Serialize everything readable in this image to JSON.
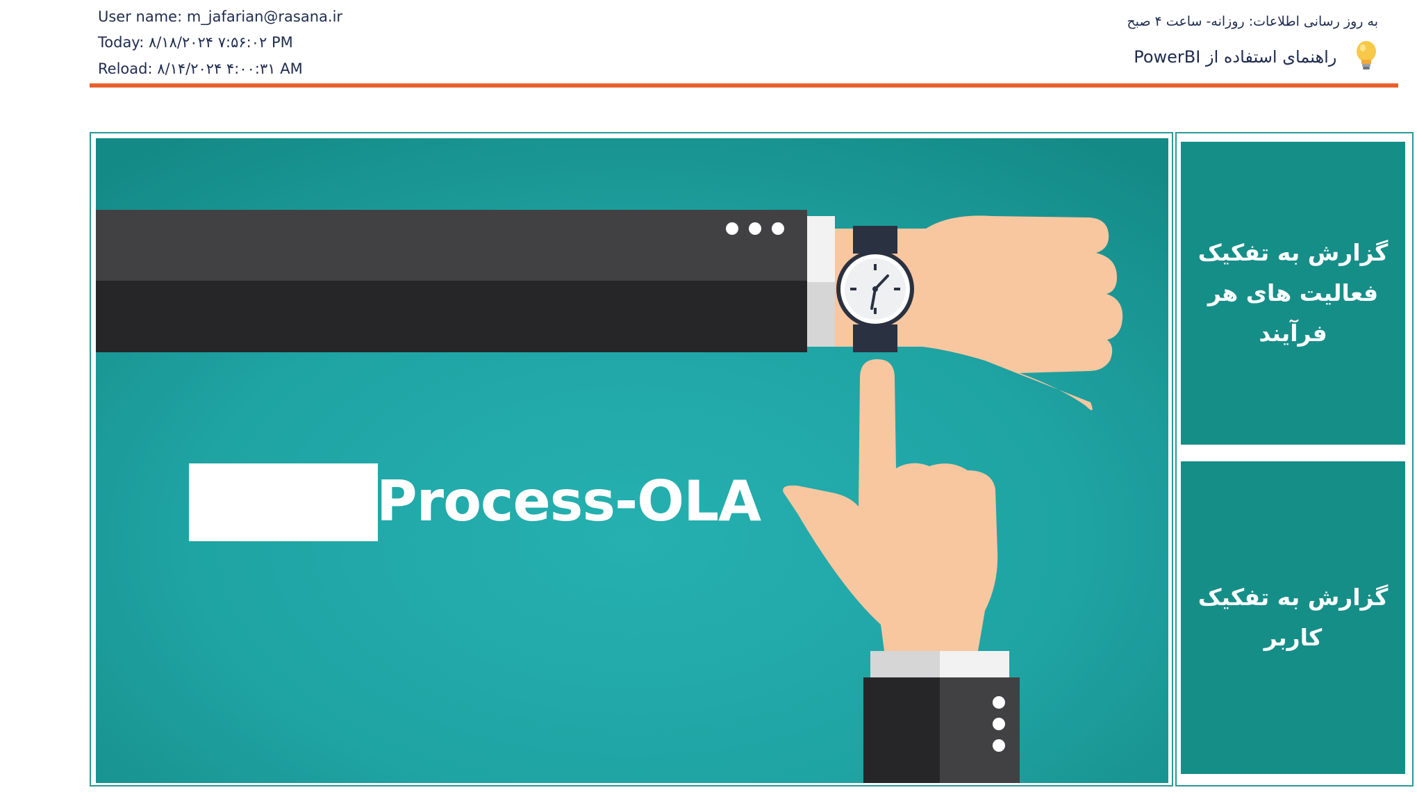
{
  "header": {
    "user_line": "User name: m_jafarian@rasana.ir",
    "today_line": "Today: ۸/۱۸/۲۰۲۴ ۷:۵۶:۰۲ PM",
    "reload_line": "Reload: ۸/۱۴/۲۰۲۴ ۴:۰۰:۳۱ AM",
    "update_note": "به روز رسانی اطلاعات: روزانه- ساعت ۴ صبح",
    "guide_link": "راهنمای استفاده از PowerBI",
    "guide_icon": "lightbulb-icon"
  },
  "banner": {
    "title": "Process-OLA"
  },
  "side_panel": {
    "buttons": [
      {
        "label": "گزارش به تفکیک فعالیت های هر فرآیند"
      },
      {
        "label": "گزارش به تفکیک کاربر"
      }
    ]
  },
  "colors": {
    "accent_rule": "#e8612c",
    "teal": "#168e88",
    "banner_bg": "#22a8a8",
    "frame_border": "#26999a"
  }
}
